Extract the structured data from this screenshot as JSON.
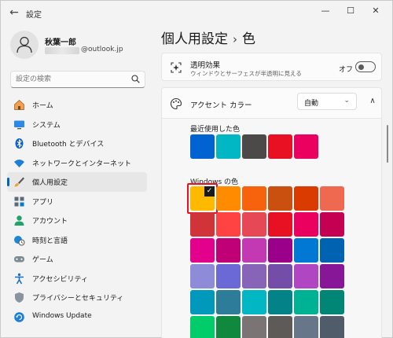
{
  "window": {
    "title": "設定",
    "back_glyph": "←",
    "minimize_glyph": "—",
    "maximize_glyph": "☐",
    "close_glyph": "✕"
  },
  "profile": {
    "name": "秋葉一郎",
    "email_suffix": "@outlook.jp"
  },
  "search": {
    "placeholder": "設定の検索"
  },
  "sidebar": {
    "items": [
      {
        "label": "ホーム",
        "icon": "home-icon",
        "active": false
      },
      {
        "label": "システム",
        "icon": "monitor-icon",
        "active": false
      },
      {
        "label": "Bluetooth とデバイス",
        "icon": "bluetooth-icon",
        "active": false
      },
      {
        "label": "ネットワークとインターネット",
        "icon": "wifi-icon",
        "active": false
      },
      {
        "label": "個人用設定",
        "icon": "brush-icon",
        "active": true
      },
      {
        "label": "アプリ",
        "icon": "apps-icon",
        "active": false
      },
      {
        "label": "アカウント",
        "icon": "person-icon",
        "active": false
      },
      {
        "label": "時刻と言語",
        "icon": "clock-globe-icon",
        "active": false
      },
      {
        "label": "ゲーム",
        "icon": "gamepad-icon",
        "active": false
      },
      {
        "label": "アクセシビリティ",
        "icon": "accessibility-icon",
        "active": false
      },
      {
        "label": "プライバシーとセキュリティ",
        "icon": "shield-icon",
        "active": false
      },
      {
        "label": "Windows Update",
        "icon": "update-icon",
        "active": false
      }
    ]
  },
  "breadcrumb": {
    "parent": "個人用設定",
    "separator": "›",
    "current": "色"
  },
  "transparency": {
    "title": "透明効果",
    "subtitle": "ウィンドウとサーフェスが半透明に見える",
    "state_label": "オフ",
    "on": false
  },
  "accent": {
    "title": "アクセント カラー",
    "dropdown_value": "自動",
    "collapse_glyph": "∧",
    "recent_label": "最近使用した色",
    "recent_colors": [
      "#0063d1",
      "#00b7c3",
      "#4c4a48",
      "#e81123",
      "#ea005e"
    ],
    "windows_label": "Windows の色",
    "check_glyph": "✓",
    "selected_index": 0,
    "windows_colors": [
      [
        "#ffb900",
        "#ff8c00",
        "#f7630c",
        "#ca5010",
        "#da3b01",
        "#ef6950"
      ],
      [
        "#d13438",
        "#ff4343",
        "#e74856",
        "#e81123",
        "#ea005e",
        "#c30052"
      ],
      [
        "#e3008c",
        "#bf0077",
        "#c239b3",
        "#9a0089",
        "#0078d4",
        "#0063b1"
      ],
      [
        "#8e8cd8",
        "#6b69d6",
        "#8764b8",
        "#744da9",
        "#b146c2",
        "#881798"
      ],
      [
        "#0099bc",
        "#2d7d9a",
        "#00b7c3",
        "#038387",
        "#00b294",
        "#018574"
      ],
      [
        "#00cc6a",
        "#10893e",
        "#7a7574",
        "#5d5a58",
        "#68768a",
        "#515c6b"
      ]
    ]
  }
}
